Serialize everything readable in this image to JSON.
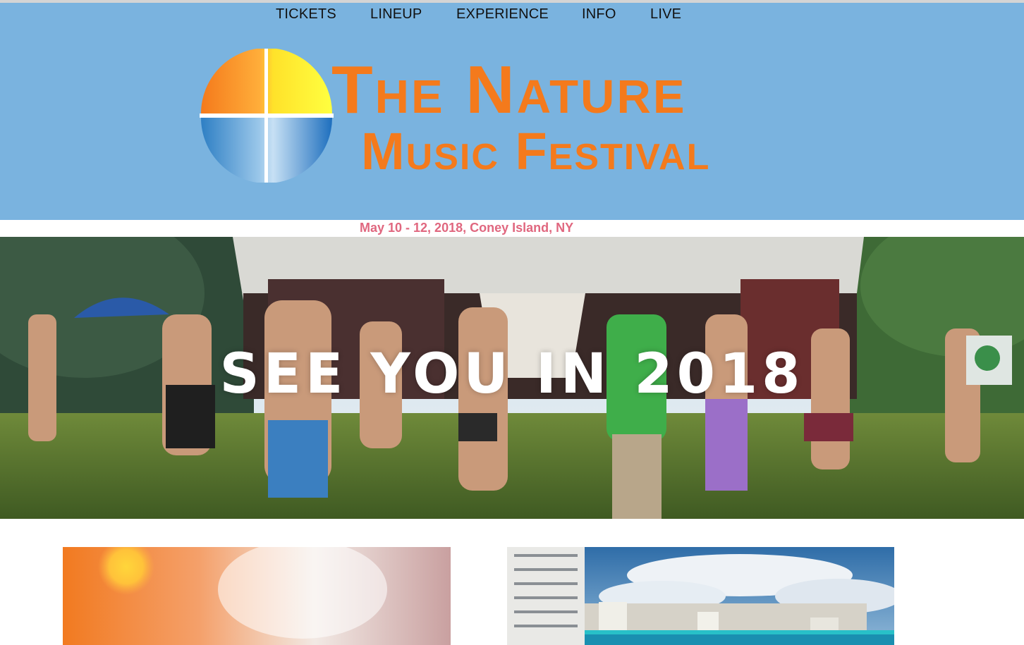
{
  "nav": {
    "items": [
      {
        "label": "TICKETS"
      },
      {
        "label": "LINEUP"
      },
      {
        "label": "EXPERIENCE"
      },
      {
        "label": "INFO"
      },
      {
        "label": "LIVE"
      }
    ]
  },
  "logo": {
    "title_line1": "The Nature",
    "title_line2": "Music Festival"
  },
  "event": {
    "dates": "May 10 - 12, 2018, Coney Island, NY"
  },
  "hero": {
    "headline": "SEE YOU IN 2018"
  },
  "colors": {
    "header_bg": "#7ab3df",
    "logo_orange": "#f47a1c",
    "date_pink": "#e0677f"
  }
}
